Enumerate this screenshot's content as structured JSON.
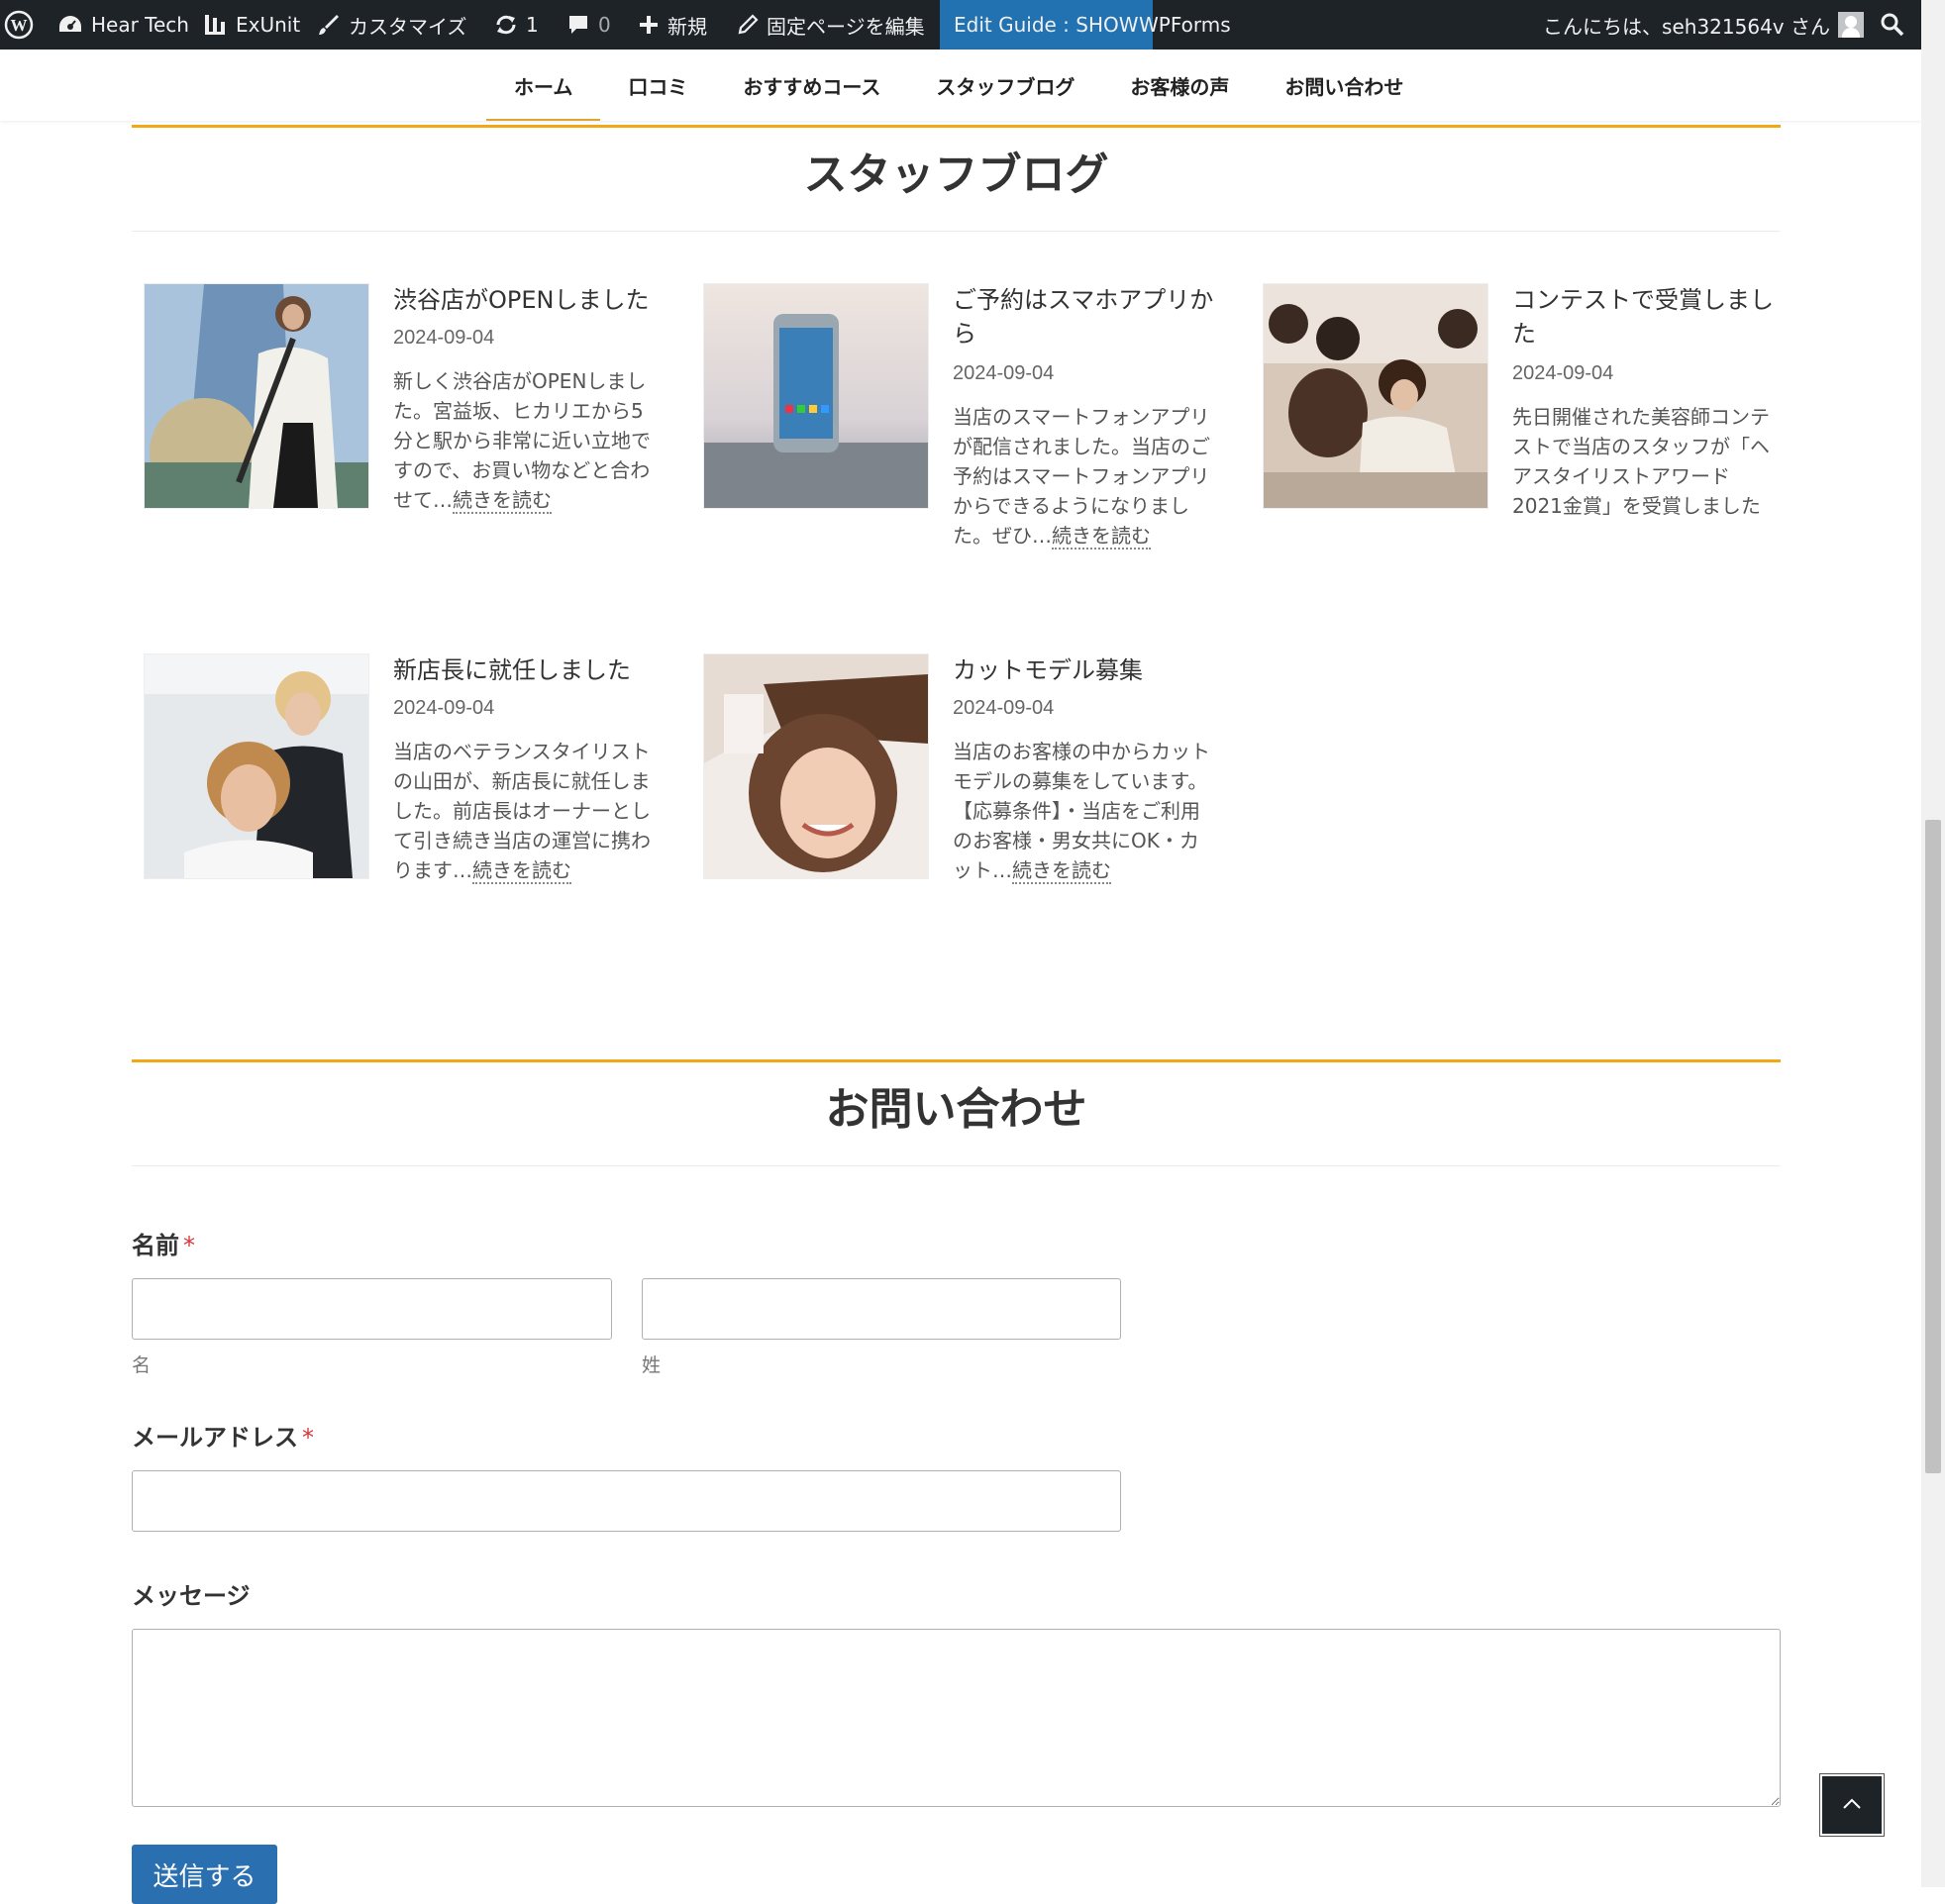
{
  "adminbar": {
    "site_name": "Hear Tech",
    "exunit": "ExUnit",
    "customize": "カスタマイズ",
    "updates_count": "1",
    "comments_count": "0",
    "new": "新規",
    "edit_page": "固定ページを編集",
    "edit_guide": "Edit Guide : SHOW",
    "wpforms": "WPForms",
    "greeting": "こんにちは、seh321564v さん"
  },
  "nav": {
    "items": [
      {
        "label": "ホーム"
      },
      {
        "label": "口コミ"
      },
      {
        "label": "おすすめコース"
      },
      {
        "label": "スタッフブログ"
      },
      {
        "label": "お客様の声"
      },
      {
        "label": "お問い合わせ"
      }
    ]
  },
  "blog": {
    "heading": "スタッフブログ",
    "read_more": "続きを読む",
    "posts": [
      {
        "title": "渋谷店がOPENしました",
        "date": "2024-09-04",
        "excerpt": "新しく渋谷店がOPENしました。宮益坂、ヒカリエから5分と駅から非常に近い立地ですので、お買い物などと合わせて…",
        "read_more": "続きを読む"
      },
      {
        "title": "ご予約はスマホアプリから",
        "date": "2024-09-04",
        "excerpt": "当店のスマートフォンアプリが配信されました。当店のご予約はスマートフォンアプリからできるようになりました。ぜひ…",
        "read_more": "続きを読む"
      },
      {
        "title": "コンテストで受賞しました",
        "date": "2024-09-04",
        "excerpt": "先日開催された美容師コンテストで当店のスタッフが「ヘアスタイリストアワード2021金賞」を受賞しました"
      },
      {
        "title": "新店長に就任しました",
        "date": "2024-09-04",
        "excerpt": "当店のベテランスタイリストの山田が、新店長に就任しました。前店長はオーナーとして引き続き当店の運営に携わります…",
        "read_more": "続きを読む"
      },
      {
        "title": "カットモデル募集",
        "date": "2024-09-04",
        "excerpt": "当店のお客様の中からカットモデルの募集をしています。【応募条件】・当店をご利用のお客様・男女共にOK・カット…",
        "read_more": "続きを読む"
      }
    ]
  },
  "contact": {
    "heading": "お問い合わせ",
    "name_label": "名前",
    "required_mark": "*",
    "first_name_sub": "名",
    "last_name_sub": "姓",
    "email_label": "メールアドレス",
    "message_label": "メッセージ",
    "submit": "送信する"
  },
  "colors": {
    "accent": "#f0a817",
    "adminbar": "#1d2327",
    "edit_guide_bg": "#2271b1",
    "submit_bg": "#2a6fb0",
    "required": "#d63638"
  },
  "icons": [
    "wordpress-icon",
    "dashboard-icon",
    "exunit-icon",
    "brush-icon",
    "refresh-icon",
    "comment-icon",
    "plus-icon",
    "pencil-icon",
    "avatar",
    "search-icon",
    "chevron-up-icon"
  ]
}
